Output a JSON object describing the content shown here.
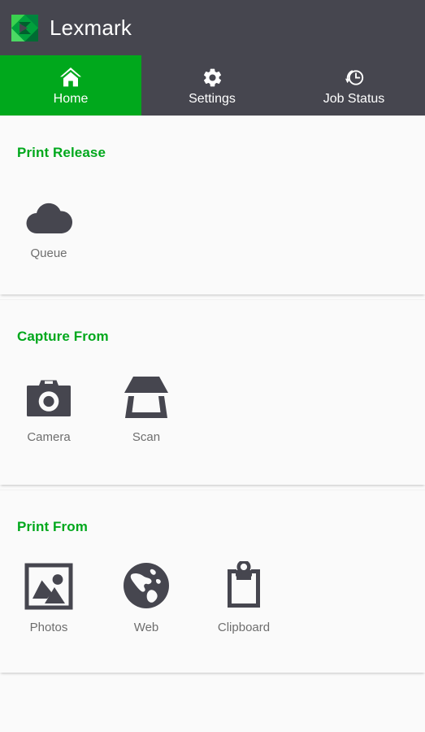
{
  "app": {
    "brand_name": "Lexmark",
    "brand_logo_icon": "lexmark-diamond-logo-icon",
    "header_bg": "#46464f",
    "accent_green": "#00a81c",
    "page_bg": "#fafafa",
    "icon_color": "#46464f",
    "label_color": "#6e6e6e"
  },
  "tabs": [
    {
      "id": "home",
      "label": "Home",
      "icon": "home-icon",
      "active": true
    },
    {
      "id": "settings",
      "label": "Settings",
      "icon": "gear-icon",
      "active": false
    },
    {
      "id": "job-status",
      "label": "Job Status",
      "icon": "clock-history-icon",
      "active": false
    }
  ],
  "sections": [
    {
      "id": "print-release",
      "title": "Print Release",
      "tiles": [
        {
          "id": "queue",
          "label": "Queue",
          "icon": "cloud-icon"
        }
      ]
    },
    {
      "id": "capture-from",
      "title": "Capture From",
      "tiles": [
        {
          "id": "camera",
          "label": "Camera",
          "icon": "camera-icon"
        },
        {
          "id": "scan",
          "label": "Scan",
          "icon": "scanner-icon"
        }
      ]
    },
    {
      "id": "print-from",
      "title": "Print From",
      "tiles": [
        {
          "id": "photos",
          "label": "Photos",
          "icon": "image-icon"
        },
        {
          "id": "web",
          "label": "Web",
          "icon": "globe-icon"
        },
        {
          "id": "clipboard",
          "label": "Clipboard",
          "icon": "clipboard-icon"
        }
      ]
    }
  ]
}
